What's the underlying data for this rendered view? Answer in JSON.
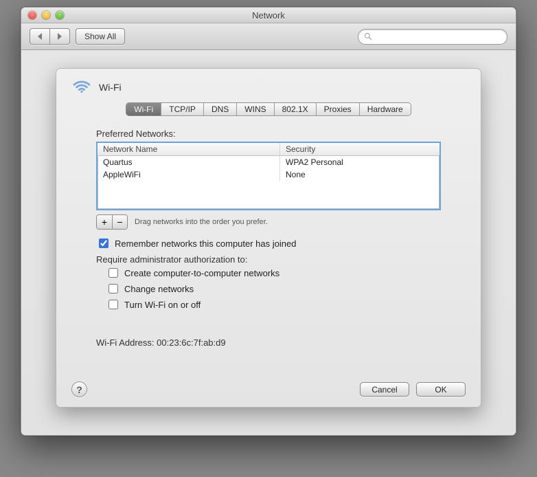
{
  "window": {
    "title": "Network"
  },
  "toolbar": {
    "show_all": "Show All",
    "search_placeholder": ""
  },
  "sheet": {
    "title": "Wi-Fi",
    "tabs": [
      "Wi-Fi",
      "TCP/IP",
      "DNS",
      "WINS",
      "802.1X",
      "Proxies",
      "Hardware"
    ],
    "active_tab": 0,
    "preferred_label": "Preferred Networks:",
    "columns": {
      "name": "Network Name",
      "security": "Security"
    },
    "networks": [
      {
        "name": "Quartus",
        "security": "WPA2 Personal"
      },
      {
        "name": "AppleWiFi",
        "security": "None"
      }
    ],
    "drag_hint": "Drag networks into the order you prefer.",
    "remember_label": "Remember networks this computer has joined",
    "remember_checked": true,
    "require_label": "Require administrator authorization to:",
    "auth_opts": [
      {
        "label": "Create computer-to-computer networks",
        "checked": false
      },
      {
        "label": "Change networks",
        "checked": false
      },
      {
        "label": "Turn Wi-Fi on or off",
        "checked": false
      }
    ],
    "mac_label": "Wi-Fi Address:",
    "mac_value": "00:23:6c:7f:ab:d9",
    "cancel": "Cancel",
    "ok": "OK"
  }
}
